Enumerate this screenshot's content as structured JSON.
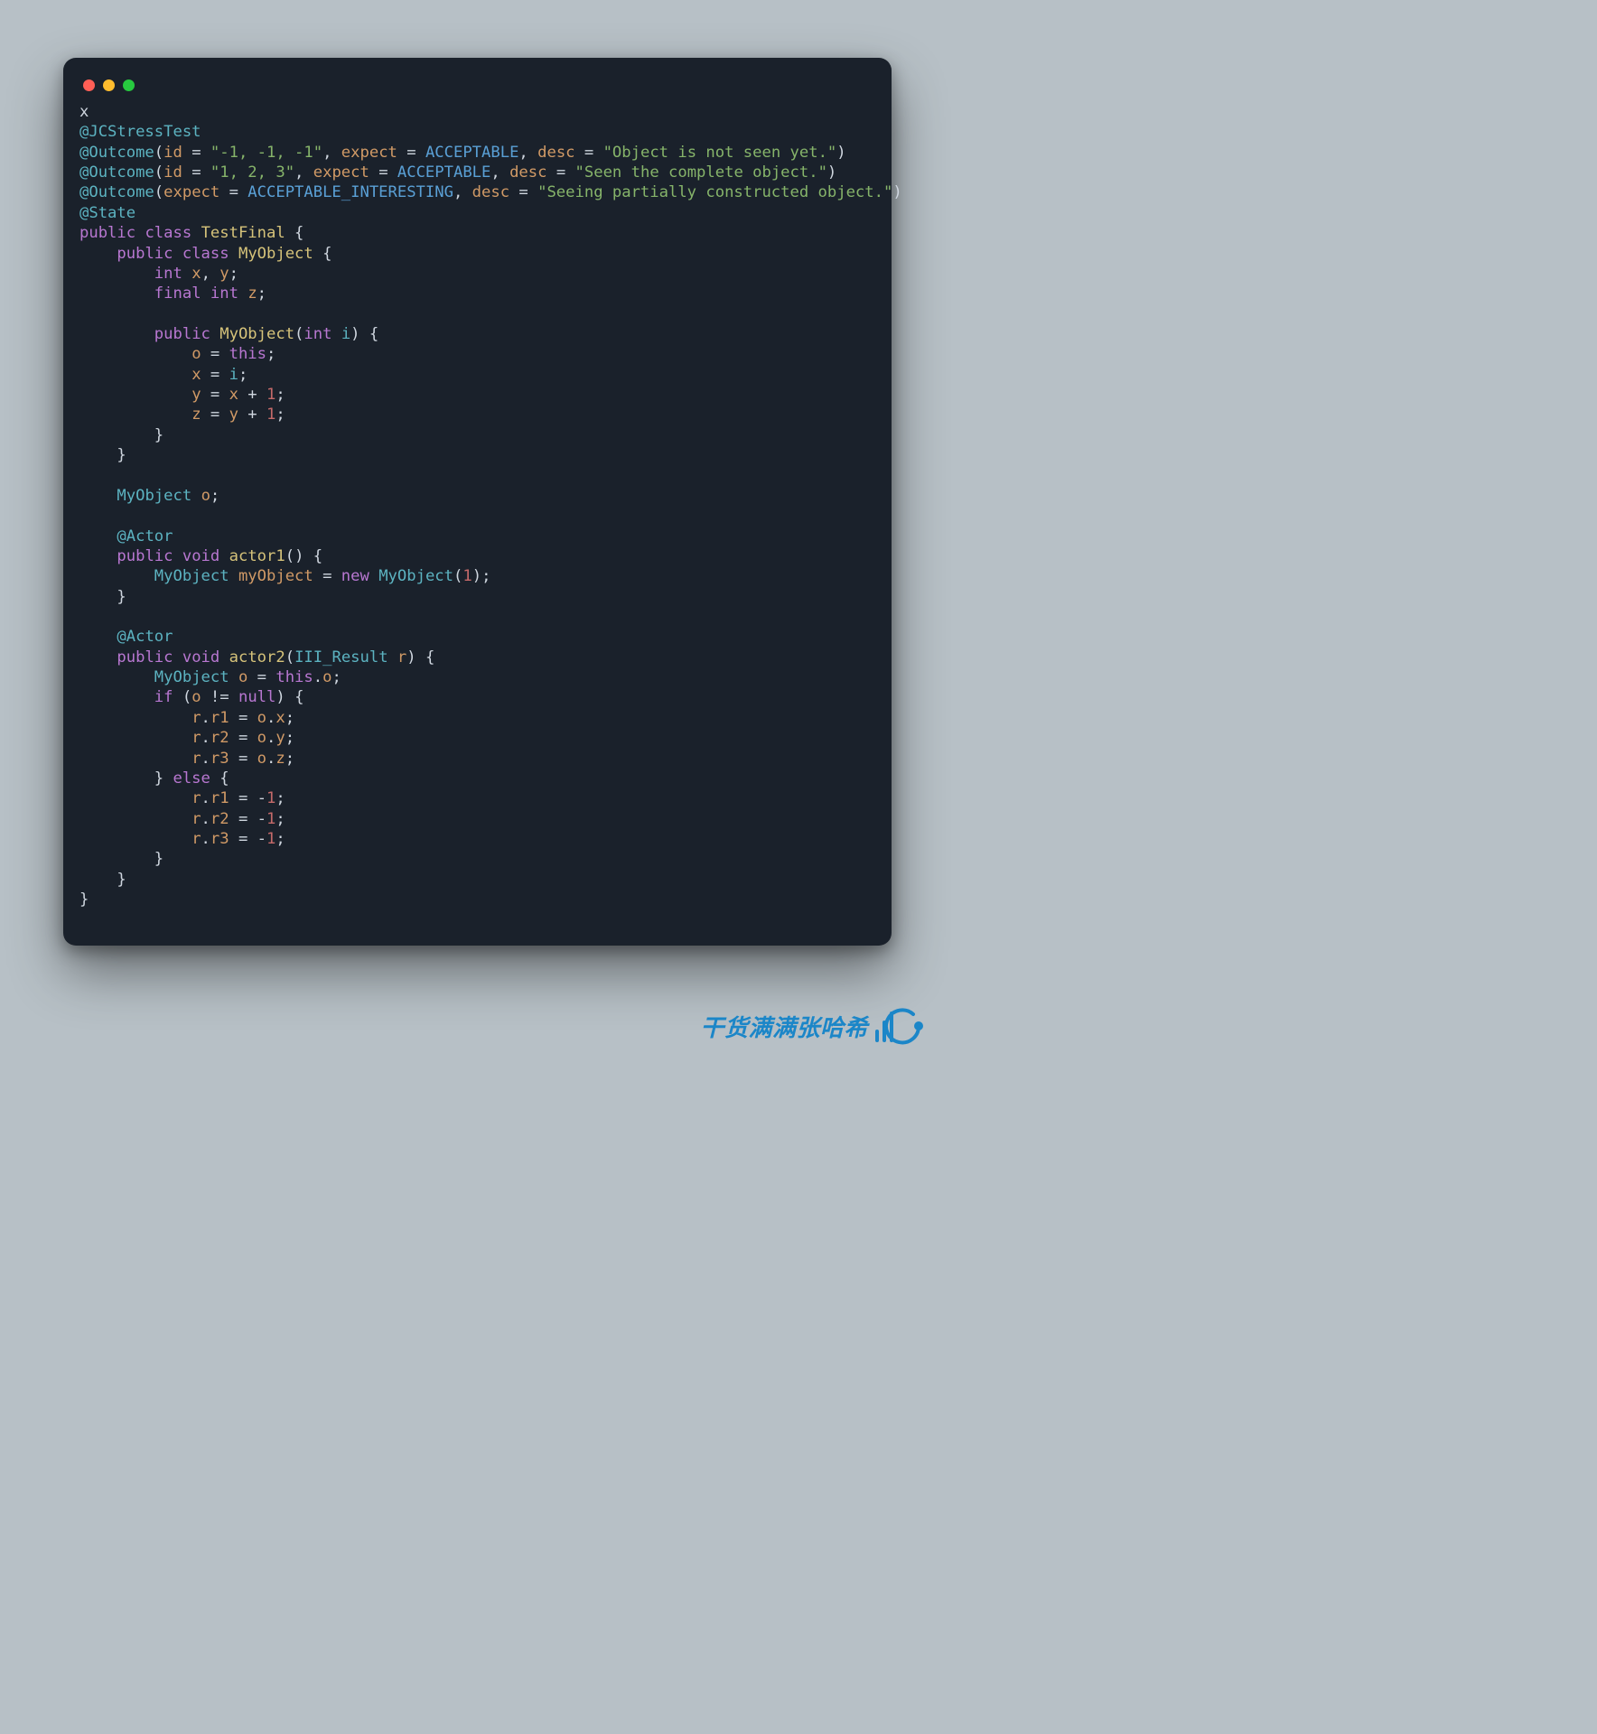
{
  "code": {
    "tokens": [
      [
        [
          "plain",
          "x"
        ]
      ],
      [
        [
          "ann",
          "@JCStressTest"
        ]
      ],
      [
        [
          "ann",
          "@Outcome"
        ],
        [
          "plain",
          "("
        ],
        [
          "param",
          "id"
        ],
        [
          "plain",
          " = "
        ],
        [
          "str",
          "\"-1, -1, -1\""
        ],
        [
          "plain",
          ", "
        ],
        [
          "param",
          "expect"
        ],
        [
          "plain",
          " = "
        ],
        [
          "const",
          "ACCEPTABLE"
        ],
        [
          "plain",
          ", "
        ],
        [
          "param",
          "desc"
        ],
        [
          "plain",
          " = "
        ],
        [
          "str",
          "\"Object is not seen yet.\""
        ],
        [
          "plain",
          ")"
        ]
      ],
      [
        [
          "ann",
          "@Outcome"
        ],
        [
          "plain",
          "("
        ],
        [
          "param",
          "id"
        ],
        [
          "plain",
          " = "
        ],
        [
          "str",
          "\"1, 2, 3\""
        ],
        [
          "plain",
          ", "
        ],
        [
          "param",
          "expect"
        ],
        [
          "plain",
          " = "
        ],
        [
          "const",
          "ACCEPTABLE"
        ],
        [
          "plain",
          ", "
        ],
        [
          "param",
          "desc"
        ],
        [
          "plain",
          " = "
        ],
        [
          "str",
          "\"Seen the complete object.\""
        ],
        [
          "plain",
          ")"
        ]
      ],
      [
        [
          "ann",
          "@Outcome"
        ],
        [
          "plain",
          "("
        ],
        [
          "param",
          "expect"
        ],
        [
          "plain",
          " = "
        ],
        [
          "const",
          "ACCEPTABLE_INTERESTING"
        ],
        [
          "plain",
          ", "
        ],
        [
          "param",
          "desc"
        ],
        [
          "plain",
          " = "
        ],
        [
          "str",
          "\"Seeing partially constructed object.\""
        ],
        [
          "plain",
          ")"
        ]
      ],
      [
        [
          "ann",
          "@State"
        ]
      ],
      [
        [
          "key",
          "public"
        ],
        [
          "plain",
          " "
        ],
        [
          "key",
          "class"
        ],
        [
          "plain",
          " "
        ],
        [
          "method",
          "TestFinal"
        ],
        [
          "plain",
          " {"
        ]
      ],
      [
        [
          "plain",
          "    "
        ],
        [
          "key",
          "public"
        ],
        [
          "plain",
          " "
        ],
        [
          "key",
          "class"
        ],
        [
          "plain",
          " "
        ],
        [
          "method",
          "MyObject"
        ],
        [
          "plain",
          " {"
        ]
      ],
      [
        [
          "plain",
          "        "
        ],
        [
          "key",
          "int"
        ],
        [
          "plain",
          " "
        ],
        [
          "param",
          "x"
        ],
        [
          "plain",
          ", "
        ],
        [
          "param",
          "y"
        ],
        [
          "plain",
          ";"
        ]
      ],
      [
        [
          "plain",
          "        "
        ],
        [
          "key",
          "final"
        ],
        [
          "plain",
          " "
        ],
        [
          "key",
          "int"
        ],
        [
          "plain",
          " "
        ],
        [
          "param",
          "z"
        ],
        [
          "plain",
          ";"
        ]
      ],
      [],
      [
        [
          "plain",
          "        "
        ],
        [
          "key",
          "public"
        ],
        [
          "plain",
          " "
        ],
        [
          "method",
          "MyObject"
        ],
        [
          "plain",
          "("
        ],
        [
          "key",
          "int"
        ],
        [
          "plain",
          " "
        ],
        [
          "ann",
          "i"
        ],
        [
          "plain",
          ") {"
        ]
      ],
      [
        [
          "plain",
          "            "
        ],
        [
          "param",
          "o"
        ],
        [
          "plain",
          " = "
        ],
        [
          "key",
          "this"
        ],
        [
          "plain",
          ";"
        ]
      ],
      [
        [
          "plain",
          "            "
        ],
        [
          "param",
          "x"
        ],
        [
          "plain",
          " = "
        ],
        [
          "ann",
          "i"
        ],
        [
          "plain",
          ";"
        ]
      ],
      [
        [
          "plain",
          "            "
        ],
        [
          "param",
          "y"
        ],
        [
          "plain",
          " = "
        ],
        [
          "param",
          "x"
        ],
        [
          "plain",
          " + "
        ],
        [
          "num",
          "1"
        ],
        [
          "plain",
          ";"
        ]
      ],
      [
        [
          "plain",
          "            "
        ],
        [
          "param",
          "z"
        ],
        [
          "plain",
          " = "
        ],
        [
          "param",
          "y"
        ],
        [
          "plain",
          " + "
        ],
        [
          "num",
          "1"
        ],
        [
          "plain",
          ";"
        ]
      ],
      [
        [
          "plain",
          "        }"
        ]
      ],
      [
        [
          "plain",
          "    }"
        ]
      ],
      [],
      [
        [
          "plain",
          "    "
        ],
        [
          "ann",
          "MyObject"
        ],
        [
          "plain",
          " "
        ],
        [
          "param",
          "o"
        ],
        [
          "plain",
          ";"
        ]
      ],
      [],
      [
        [
          "plain",
          "    "
        ],
        [
          "ann",
          "@Actor"
        ]
      ],
      [
        [
          "plain",
          "    "
        ],
        [
          "key",
          "public"
        ],
        [
          "plain",
          " "
        ],
        [
          "key",
          "void"
        ],
        [
          "plain",
          " "
        ],
        [
          "method",
          "actor1"
        ],
        [
          "plain",
          "() {"
        ]
      ],
      [
        [
          "plain",
          "        "
        ],
        [
          "ann",
          "MyObject"
        ],
        [
          "plain",
          " "
        ],
        [
          "param",
          "myObject"
        ],
        [
          "plain",
          " = "
        ],
        [
          "key",
          "new"
        ],
        [
          "plain",
          " "
        ],
        [
          "ann",
          "MyObject"
        ],
        [
          "plain",
          "("
        ],
        [
          "num",
          "1"
        ],
        [
          "plain",
          ");"
        ]
      ],
      [
        [
          "plain",
          "    }"
        ]
      ],
      [],
      [
        [
          "plain",
          "    "
        ],
        [
          "ann",
          "@Actor"
        ]
      ],
      [
        [
          "plain",
          "    "
        ],
        [
          "key",
          "public"
        ],
        [
          "plain",
          " "
        ],
        [
          "key",
          "void"
        ],
        [
          "plain",
          " "
        ],
        [
          "method",
          "actor2"
        ],
        [
          "plain",
          "("
        ],
        [
          "ann",
          "III_Result"
        ],
        [
          "plain",
          " "
        ],
        [
          "param",
          "r"
        ],
        [
          "plain",
          ") {"
        ]
      ],
      [
        [
          "plain",
          "        "
        ],
        [
          "ann",
          "MyObject"
        ],
        [
          "plain",
          " "
        ],
        [
          "param",
          "o"
        ],
        [
          "plain",
          " = "
        ],
        [
          "key",
          "this"
        ],
        [
          "plain",
          "."
        ],
        [
          "param",
          "o"
        ],
        [
          "plain",
          ";"
        ]
      ],
      [
        [
          "plain",
          "        "
        ],
        [
          "key",
          "if"
        ],
        [
          "plain",
          " ("
        ],
        [
          "param",
          "o"
        ],
        [
          "plain",
          " != "
        ],
        [
          "key",
          "null"
        ],
        [
          "plain",
          ") {"
        ]
      ],
      [
        [
          "plain",
          "            "
        ],
        [
          "param",
          "r"
        ],
        [
          "plain",
          "."
        ],
        [
          "param",
          "r1"
        ],
        [
          "plain",
          " = "
        ],
        [
          "param",
          "o"
        ],
        [
          "plain",
          "."
        ],
        [
          "param",
          "x"
        ],
        [
          "plain",
          ";"
        ]
      ],
      [
        [
          "plain",
          "            "
        ],
        [
          "param",
          "r"
        ],
        [
          "plain",
          "."
        ],
        [
          "param",
          "r2"
        ],
        [
          "plain",
          " = "
        ],
        [
          "param",
          "o"
        ],
        [
          "plain",
          "."
        ],
        [
          "param",
          "y"
        ],
        [
          "plain",
          ";"
        ]
      ],
      [
        [
          "plain",
          "            "
        ],
        [
          "param",
          "r"
        ],
        [
          "plain",
          "."
        ],
        [
          "param",
          "r3"
        ],
        [
          "plain",
          " = "
        ],
        [
          "param",
          "o"
        ],
        [
          "plain",
          "."
        ],
        [
          "param",
          "z"
        ],
        [
          "plain",
          ";"
        ]
      ],
      [
        [
          "plain",
          "        } "
        ],
        [
          "key",
          "else"
        ],
        [
          "plain",
          " {"
        ]
      ],
      [
        [
          "plain",
          "            "
        ],
        [
          "param",
          "r"
        ],
        [
          "plain",
          "."
        ],
        [
          "param",
          "r1"
        ],
        [
          "plain",
          " = -"
        ],
        [
          "num",
          "1"
        ],
        [
          "plain",
          ";"
        ]
      ],
      [
        [
          "plain",
          "            "
        ],
        [
          "param",
          "r"
        ],
        [
          "plain",
          "."
        ],
        [
          "param",
          "r2"
        ],
        [
          "plain",
          " = -"
        ],
        [
          "num",
          "1"
        ],
        [
          "plain",
          ";"
        ]
      ],
      [
        [
          "plain",
          "            "
        ],
        [
          "param",
          "r"
        ],
        [
          "plain",
          "."
        ],
        [
          "param",
          "r3"
        ],
        [
          "plain",
          " = -"
        ],
        [
          "num",
          "1"
        ],
        [
          "plain",
          ";"
        ]
      ],
      [
        [
          "plain",
          "        }"
        ]
      ],
      [
        [
          "plain",
          "    }"
        ]
      ],
      [
        [
          "plain",
          "}"
        ]
      ]
    ]
  },
  "watermark": {
    "text": "干货满满张哈希"
  }
}
